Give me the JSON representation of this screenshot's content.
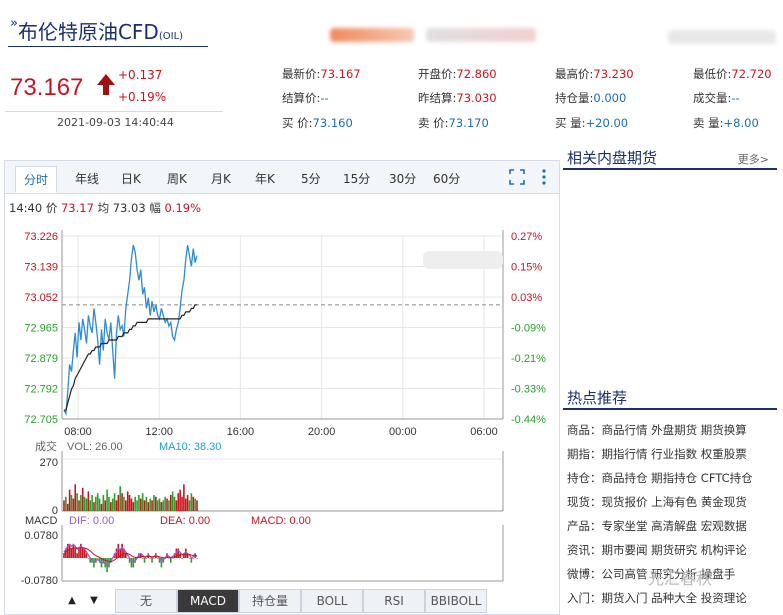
{
  "header": {
    "title": "布伦特原油CFD",
    "title_suffix": "(OIL)",
    "title_mark": "»"
  },
  "price": {
    "last": "73.167",
    "change": "+0.137",
    "change_pct": "+0.19%",
    "timestamp": "2021-09-03 14:40:44"
  },
  "quote": {
    "rows": [
      [
        {
          "label": "最新价:",
          "value": "73.167"
        },
        {
          "label": "开盘价:",
          "value": "72.860"
        },
        {
          "label": "最高价:",
          "value": "73.230"
        },
        {
          "label": "最低价:",
          "value": "72.720"
        }
      ],
      [
        {
          "label": "结算价:",
          "value": "--"
        },
        {
          "label": "昨结算:",
          "value": "73.030"
        },
        {
          "label": "持仓量:",
          "value": "0.000"
        },
        {
          "label": "成交量:",
          "value": "--"
        }
      ],
      [
        {
          "label": "买  价:",
          "value": "73.160"
        },
        {
          "label": "卖  价:",
          "value": "73.170"
        },
        {
          "label": "买  量:",
          "value": "+20.00"
        },
        {
          "label": "卖  量:",
          "value": "+8.00"
        }
      ]
    ]
  },
  "tabs": [
    "分时",
    "年线",
    "日K",
    "周K",
    "月K",
    "年K",
    "5分",
    "15分",
    "30分",
    "60分"
  ],
  "info": {
    "time": "14:40",
    "price_label": "价",
    "price": "73.17",
    "avg_label": "均",
    "avg": "73.03",
    "amp_label": "幅",
    "amp": "0.19%"
  },
  "volume_info": {
    "label": "成交",
    "vol": "VOL: 26.00",
    "ma10": "MA10: 38.30",
    "max": "270",
    "min": "0"
  },
  "macd_info": {
    "label": "MACD",
    "dif": "DIF: 0.00",
    "dea": "DEA: 0.00",
    "macd": "MACD: 0.00",
    "max": "0.0780",
    "min": "-0.0780"
  },
  "indicator_tabs": [
    "无",
    "MACD",
    "持仓量",
    "BOLL",
    "RSI",
    "BBIBOLL"
  ],
  "nav": {
    "up": "▲",
    "down": "▼"
  },
  "side": {
    "related_title": "相关内盘期货",
    "more": "更多>",
    "hot_title": "热点推荐",
    "hot_rows": [
      "商品：商品行情 外盘期货 期货换算",
      "期指：期指行情 行业指数 权重股票",
      "持仓：商品持仓 期指持仓 CFTC持仓",
      "现货：现货报价 上海有色 黄金现货",
      "产品：专家坐堂 高清解盘 宏观数据",
      "资讯：期市要闻 期货研究 机构评论",
      "微博：公司高管 研究分析 操盘手",
      "入门：期货入门 品种大全 投资理论"
    ]
  },
  "watermark": "光汇春秋",
  "colors": {
    "up": "#c8141e",
    "down": "#2aa02a",
    "price_line": "#2d8cd0",
    "avg_line": "#222222",
    "macd_dif": "#9b59d0",
    "macd_dea": "#c8141e"
  },
  "chart_data": {
    "type": "line",
    "x_ticks": [
      "08:00",
      "12:00",
      "16:00",
      "20:00",
      "00:00",
      "06:00"
    ],
    "y_ticks_left": [
      "73.226",
      "73.139",
      "73.052",
      "72.965",
      "72.879",
      "72.792",
      "72.705"
    ],
    "y_ticks_right": [
      "0.27%",
      "0.15%",
      "0.03%",
      "-0.09%",
      "-0.21%",
      "-0.33%",
      "-0.44%"
    ],
    "ylim": [
      72.705,
      73.226
    ],
    "prev_settle": 73.03,
    "series": [
      {
        "values": [
          72.73,
          72.72,
          72.78,
          72.86,
          72.84,
          72.9,
          72.95,
          72.88,
          72.98,
          72.93,
          72.99,
          72.96,
          72.92,
          73.0,
          72.97,
          72.95,
          73.02,
          72.98,
          72.93,
          72.86,
          72.96,
          72.9,
          72.99,
          72.95,
          72.93,
          72.98,
          72.9,
          72.82,
          72.95,
          73.0,
          72.96,
          72.97,
          72.94,
          73.02,
          73.06,
          73.1,
          73.16,
          73.2,
          73.18,
          73.13,
          73.1,
          73.13,
          73.06,
          73.08,
          73.02,
          73.05,
          73.0,
          73.04,
          73.01,
          73.03,
          73.0,
          72.99,
          73.02,
          73.0,
          72.98,
          72.99,
          72.97,
          72.98,
          72.94,
          72.93,
          72.96,
          72.98,
          73.02,
          73.07,
          73.1,
          73.16,
          73.2,
          73.17,
          73.14,
          73.19,
          73.15,
          73.17
        ]
      },
      {
        "values": [
          72.73,
          72.73,
          72.75,
          72.77,
          72.79,
          72.8,
          72.82,
          72.83,
          72.84,
          72.85,
          72.86,
          72.87,
          72.88,
          72.89,
          72.89,
          72.9,
          72.9,
          72.91,
          72.91,
          72.91,
          72.92,
          72.92,
          72.92,
          72.92,
          72.93,
          72.93,
          72.93,
          72.93,
          72.93,
          72.94,
          72.94,
          72.94,
          72.95,
          72.95,
          72.95,
          72.96,
          72.96,
          72.97,
          72.97,
          72.98,
          72.98,
          72.98,
          72.98,
          72.98,
          72.98,
          72.99,
          72.99,
          72.99,
          72.99,
          72.99,
          72.99,
          72.99,
          72.99,
          72.99,
          72.99,
          72.99,
          72.99,
          72.99,
          72.99,
          72.99,
          72.99,
          72.99,
          72.99,
          73.0,
          73.0,
          73.01,
          73.01,
          73.01,
          73.02,
          73.02,
          73.03,
          73.03
        ]
      }
    ],
    "volume": [
      60,
      80,
      40,
      120,
      90,
      70,
      150,
      100,
      60,
      90,
      130,
      80,
      70,
      110,
      60,
      90,
      50,
      80,
      100,
      70,
      40,
      90,
      60,
      120,
      80,
      50,
      70,
      100,
      60,
      90,
      140,
      100,
      80,
      60,
      110,
      90,
      70,
      50,
      80,
      60,
      90,
      70,
      100,
      60,
      80,
      50,
      70,
      60,
      90,
      80,
      60,
      70,
      50,
      60,
      80,
      70,
      60,
      90,
      110,
      80,
      60,
      100,
      120,
      80,
      150,
      70,
      90,
      60,
      100,
      80,
      70,
      60
    ],
    "macd": [
      0.01,
      0.02,
      0.03,
      0.03,
      0.02,
      0.03,
      0.02,
      0.01,
      0.02,
      0.03,
      0.02,
      0.02,
      0.01,
      0.0,
      -0.01,
      -0.01,
      -0.02,
      -0.01,
      0.0,
      -0.01,
      -0.02,
      -0.01,
      -0.02,
      -0.03,
      -0.02,
      -0.01,
      0.0,
      0.01,
      0.02,
      0.03,
      0.02,
      0.03,
      0.02,
      0.01,
      0.0,
      -0.01,
      -0.02,
      -0.02,
      -0.01,
      0.0,
      0.01,
      0.01,
      0.0,
      -0.01,
      0.0,
      0.01,
      0.0,
      -0.01,
      0.0,
      0.01,
      0.0,
      -0.01,
      -0.02,
      -0.01,
      0.0,
      0.01,
      0.0,
      -0.01,
      0.0,
      0.01,
      0.02,
      0.02,
      0.01,
      0.0,
      0.01,
      0.02,
      0.01,
      0.0,
      -0.01,
      0.0,
      0.01,
      0.0
    ],
    "dif": [
      0.02,
      0.03,
      0.04,
      0.045,
      0.04,
      0.045,
      0.04,
      0.03,
      0.035,
      0.04,
      0.035,
      0.03,
      0.02,
      0.01,
      0.0,
      -0.01,
      -0.015,
      -0.01,
      -0.005,
      -0.01,
      -0.02,
      -0.015,
      -0.02,
      -0.025,
      -0.02,
      -0.01,
      0.0,
      0.01,
      0.02,
      0.03,
      0.03,
      0.035,
      0.03,
      0.02,
      0.01,
      0.0,
      -0.01,
      -0.015,
      -0.01,
      0.0,
      0.01,
      0.015,
      0.01,
      0.0,
      0.005,
      0.01,
      0.005,
      0.0,
      0.005,
      0.01,
      0.005,
      0.0,
      -0.01,
      -0.005,
      0.0,
      0.01,
      0.005,
      0.0,
      0.005,
      0.01,
      0.02,
      0.025,
      0.02,
      0.01,
      0.015,
      0.02,
      0.015,
      0.01,
      0.0,
      0.005,
      0.01,
      0.005
    ],
    "dea": [
      0.015,
      0.02,
      0.025,
      0.03,
      0.032,
      0.034,
      0.035,
      0.034,
      0.034,
      0.035,
      0.035,
      0.034,
      0.032,
      0.028,
      0.024,
      0.018,
      0.012,
      0.008,
      0.005,
      0.002,
      -0.002,
      -0.005,
      -0.008,
      -0.01,
      -0.012,
      -0.012,
      -0.01,
      -0.006,
      -0.002,
      0.003,
      0.008,
      0.012,
      0.015,
      0.016,
      0.015,
      0.012,
      0.008,
      0.004,
      0.002,
      0.001,
      0.002,
      0.004,
      0.005,
      0.004,
      0.004,
      0.005,
      0.005,
      0.004,
      0.004,
      0.005,
      0.005,
      0.004,
      0.002,
      0.001,
      0.001,
      0.002,
      0.003,
      0.002,
      0.002,
      0.003,
      0.006,
      0.009,
      0.011,
      0.011,
      0.012,
      0.013,
      0.013,
      0.012,
      0.01,
      0.009,
      0.009,
      0.008
    ]
  }
}
